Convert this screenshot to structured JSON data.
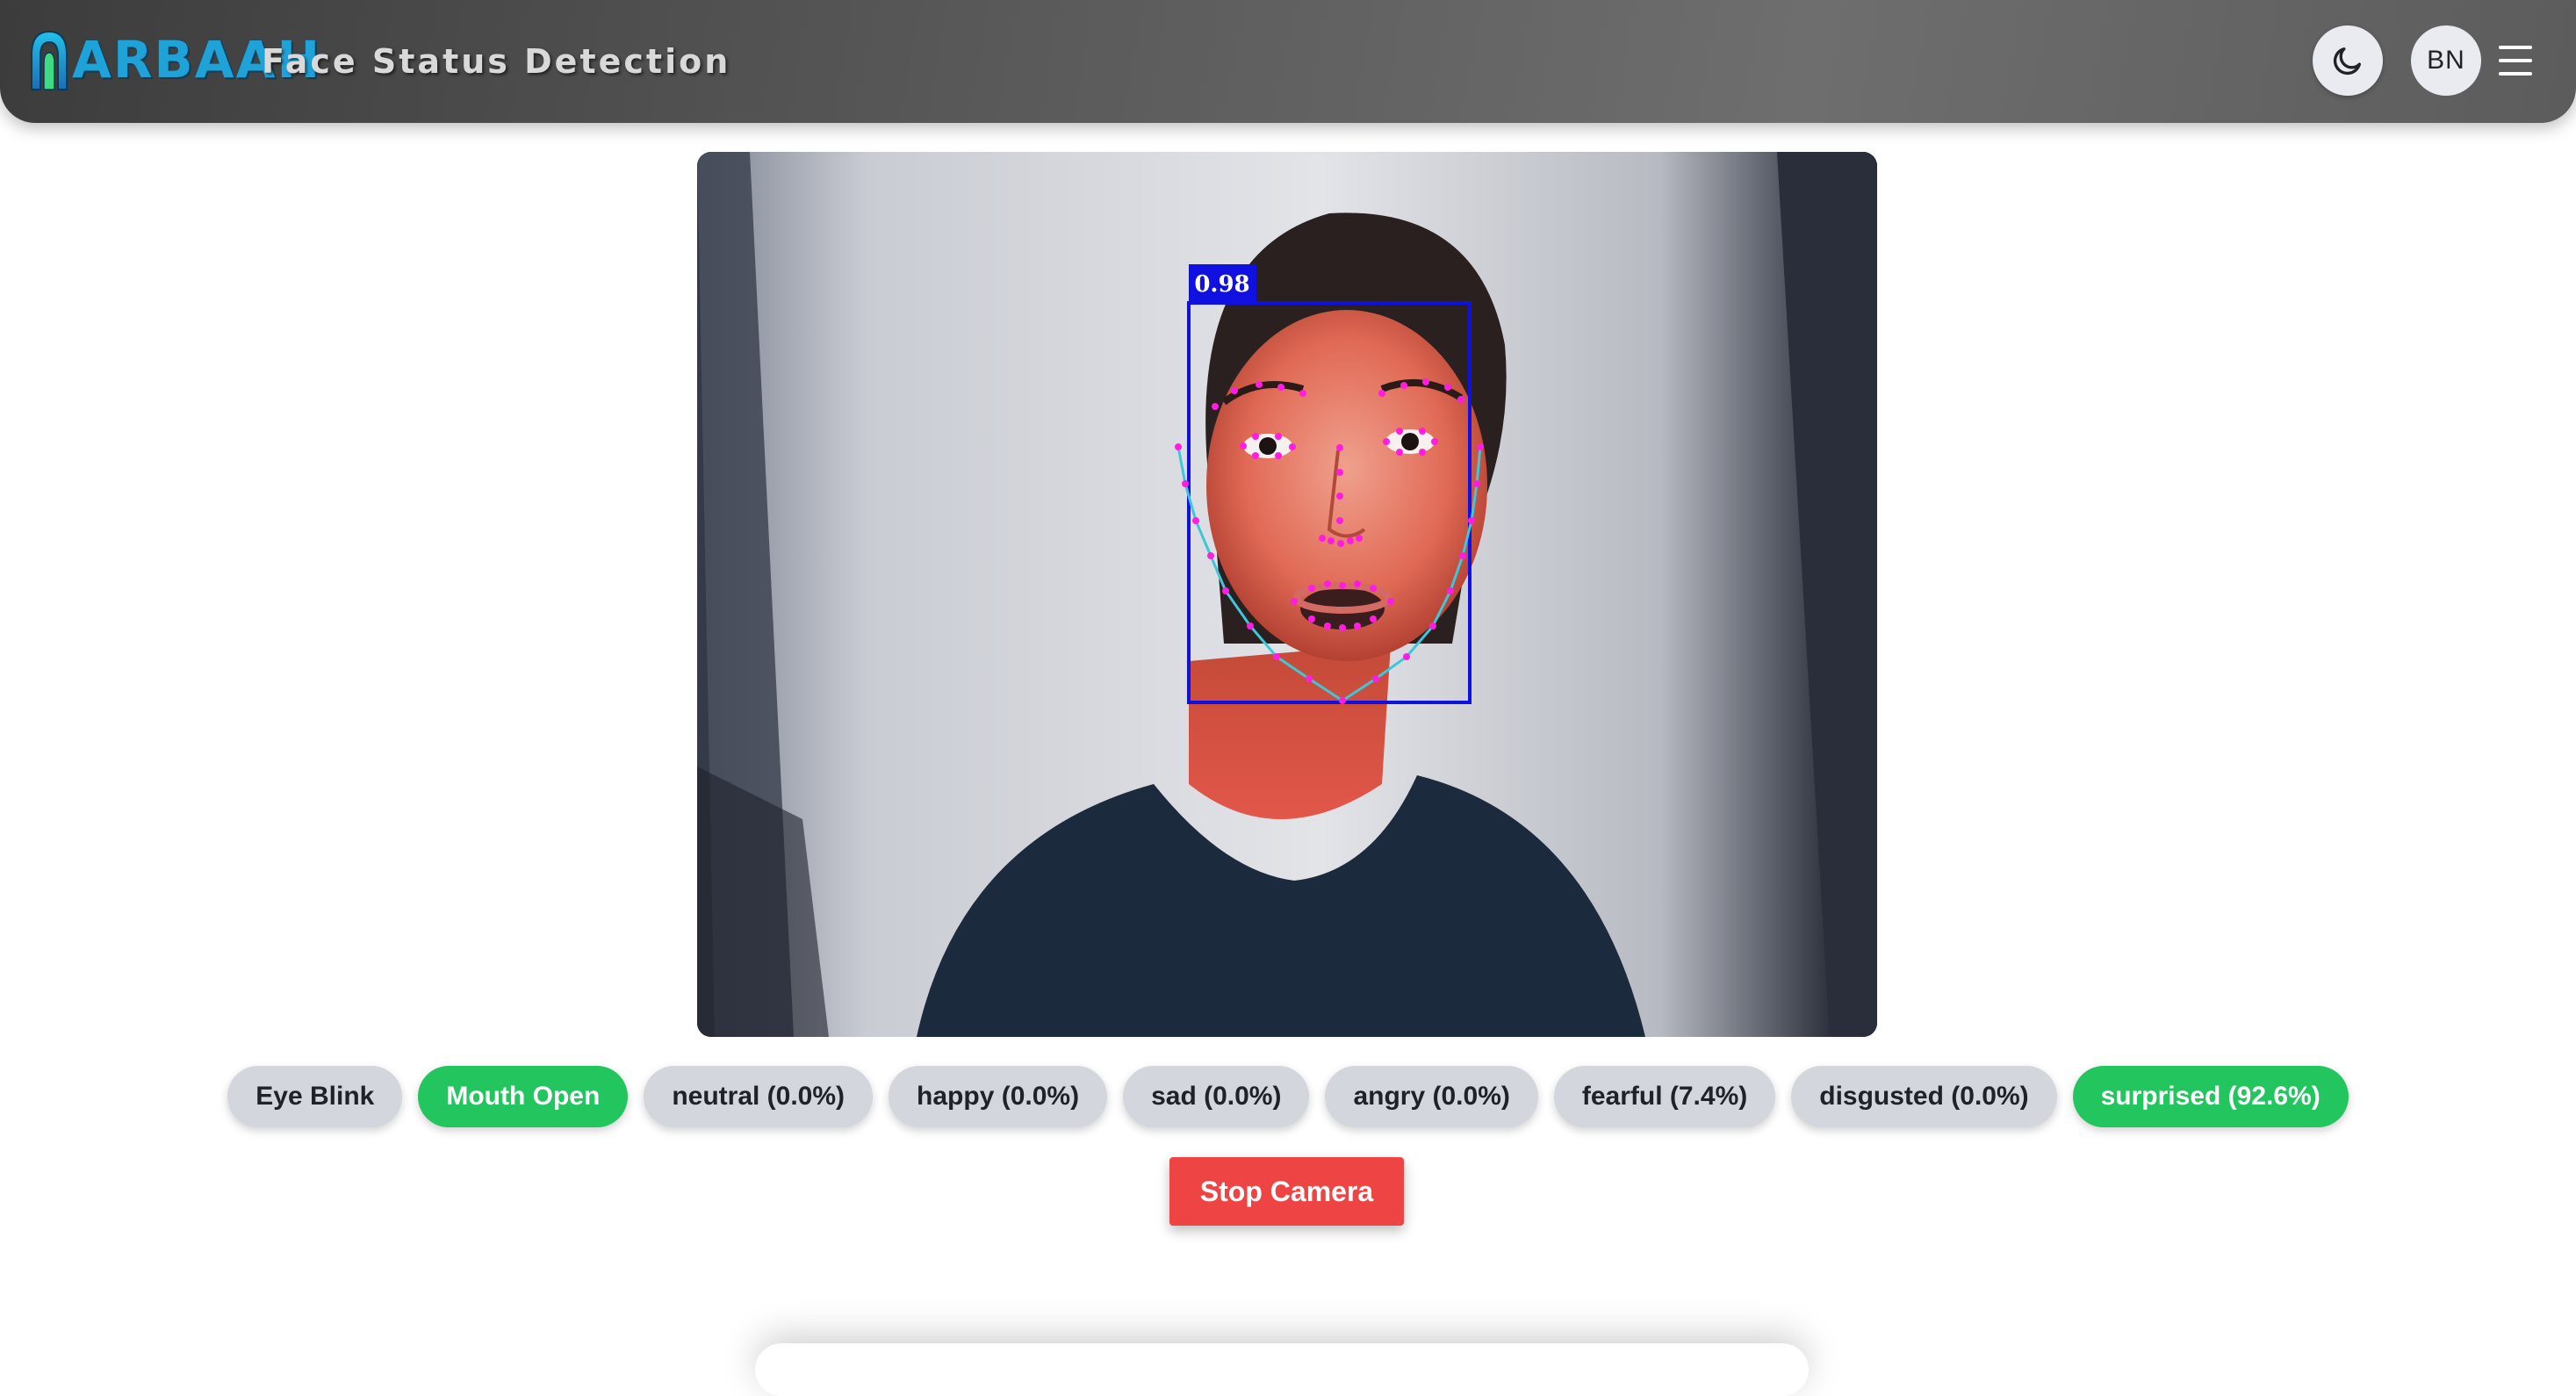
{
  "header": {
    "brand": "ARBAAH",
    "app_title": "Face Status Detection",
    "theme_icon": "moon-icon",
    "avatar_initials": "BN",
    "menu_icon": "hamburger-menu-icon"
  },
  "camera": {
    "detection_score": "0.98",
    "box_color": "#1010e0",
    "landmark_color": "#ff1de0",
    "contour_color": "#3ec7d8"
  },
  "status_chips": [
    {
      "label": "Eye Blink",
      "active": false
    },
    {
      "label": "Mouth Open",
      "active": true
    },
    {
      "label": "neutral (0.0%)",
      "active": false
    },
    {
      "label": "happy (0.0%)",
      "active": false
    },
    {
      "label": "sad (0.0%)",
      "active": false
    },
    {
      "label": "angry (0.0%)",
      "active": false
    },
    {
      "label": "fearful (7.4%)",
      "active": false
    },
    {
      "label": "disgusted (0.0%)",
      "active": false
    },
    {
      "label": "surprised (92.6%)",
      "active": true
    }
  ],
  "controls": {
    "stop_label": "Stop Camera"
  },
  "colors": {
    "active_chip": "#22c55e",
    "inactive_chip": "#d3d6dc",
    "stop_button": "#ef4444"
  }
}
